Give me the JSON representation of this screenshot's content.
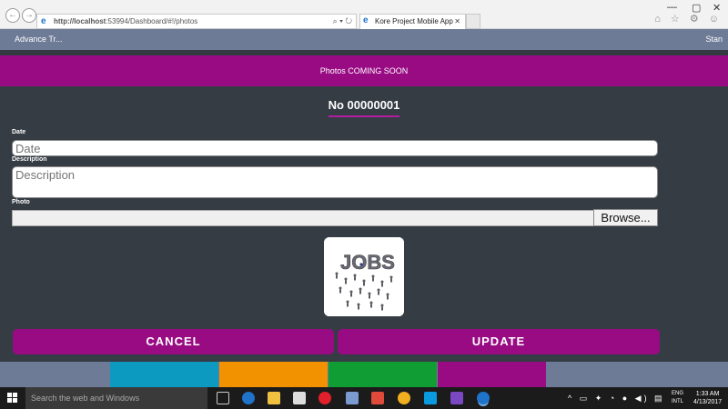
{
  "browser": {
    "url_host": "http://localhost",
    "url_path": ":53994/Dashboard/#!/photos",
    "addr_tools": "⌕ ▾ ↻",
    "tab_title": "Kore Project Mobile App",
    "tab_close": "✕",
    "tool_icons": "⌂ ☆ ⚙ ☺",
    "window_buttons": {
      "minimize": "—",
      "restore": "▢",
      "close": "✕"
    },
    "back": "←",
    "forward": "→"
  },
  "nav": {
    "brand": "Advance Tr...",
    "user": "Stan"
  },
  "banner": {
    "text": "Photos COMING SOON"
  },
  "record": {
    "title": "No 00000001"
  },
  "form": {
    "date_label": "Date",
    "date_placeholder": "Date",
    "description_label": "Description",
    "description_placeholder": "Description",
    "photo_label": "Photo",
    "browse_label": "Browse...",
    "thumbnail_text": "JOBS"
  },
  "actions": {
    "cancel": "CANCEL",
    "update": "UPDATE"
  },
  "bottom_tabs": [
    {
      "color": "#6d7b96"
    },
    {
      "color": "#0d9ac0"
    },
    {
      "color": "#f39200"
    },
    {
      "color": "#0f9d34"
    },
    {
      "color": "#980b83"
    },
    {
      "color": "#6d7b96"
    }
  ],
  "taskbar": {
    "search_placeholder": "Search the web and Windows",
    "tray_icons": "^ ▭ ✦ ◔ ● ◀) ▤",
    "lang_top": "ENG",
    "lang_bottom": "INTL",
    "time": "1:33 AM",
    "date": "4/13/2017"
  }
}
